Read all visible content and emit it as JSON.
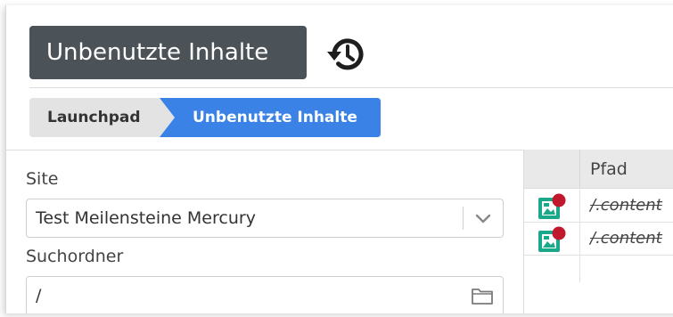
{
  "header": {
    "title": "Unbenutzte Inhalte",
    "history_icon": "history-icon"
  },
  "breadcrumb": {
    "items": [
      {
        "label": "Launchpad"
      },
      {
        "label": "Unbenutzte Inhalte"
      }
    ],
    "active_color": "#3b82e6",
    "inactive_color": "#e3e3e3"
  },
  "form": {
    "site_label": "Site",
    "site_value": "Test Meilensteine Mercury",
    "site_icon": "chevron-down-icon",
    "folder_label": "Suchordner",
    "folder_value": "/",
    "folder_icon": "folder-icon"
  },
  "table": {
    "columns": [
      "",
      "Pfad"
    ],
    "rows": [
      {
        "icon": "image-resource-icon",
        "path": "/.content"
      },
      {
        "icon": "image-resource-icon",
        "path": "/.content"
      }
    ],
    "icon_color": "#1aa88a",
    "badge_color": "#c0182d"
  }
}
